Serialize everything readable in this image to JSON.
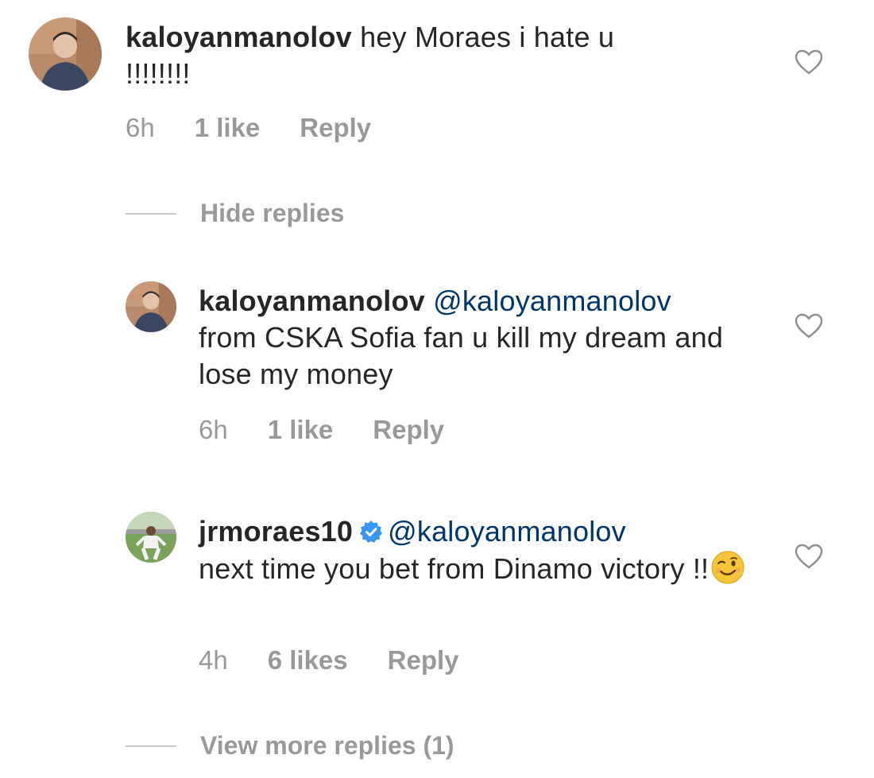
{
  "comments": [
    {
      "username": "kaloyanmanolov",
      "mention": "",
      "text": "hey Moraes i hate u !!!!!!!!",
      "time": "6h",
      "likes": "1 like",
      "reply": "Reply",
      "verified": false
    },
    {
      "username": "kaloyanmanolov",
      "mention": "@kaloyanmanolov",
      "text": "from CSKA Sofia fan u kill my dream and lose my money",
      "time": "6h",
      "likes": "1 like",
      "reply": "Reply",
      "verified": false
    },
    {
      "username": "jrmoraes10",
      "mention": "@kaloyanmanolov",
      "text": "next time you bet from Dinamo victory !!",
      "emoji": "winking-face-emoji",
      "time": "4h",
      "likes": "6 likes",
      "reply": "Reply",
      "verified": true
    }
  ],
  "hide_replies_label": "Hide replies",
  "view_more_replies_label": "View more replies (1)",
  "colors": {
    "text": "#262626",
    "secondary": "#999999",
    "mention": "#003569",
    "verified": "#3897f0"
  }
}
